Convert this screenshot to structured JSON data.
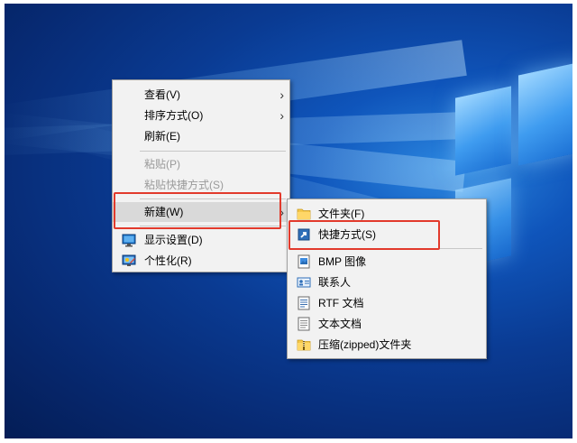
{
  "context_menu": {
    "items": [
      {
        "label": "查看(V)"
      },
      {
        "label": "排序方式(O)"
      },
      {
        "label": "刷新(E)"
      },
      {
        "label": "粘贴(P)"
      },
      {
        "label": "粘贴快捷方式(S)"
      },
      {
        "label": "新建(W)"
      },
      {
        "label": "显示设置(D)",
        "icon": "display-icon"
      },
      {
        "label": "个性化(R)",
        "icon": "personalize-icon"
      }
    ]
  },
  "submenu_new": {
    "items": [
      {
        "label": "文件夹(F)",
        "icon": "folder-icon"
      },
      {
        "label": "快捷方式(S)",
        "icon": "shortcut-icon"
      },
      {
        "label": "BMP 图像",
        "icon": "bmp-image-icon"
      },
      {
        "label": "联系人",
        "icon": "contact-icon"
      },
      {
        "label": "RTF 文档",
        "icon": "rtf-document-icon"
      },
      {
        "label": "文本文档",
        "icon": "text-document-icon"
      },
      {
        "label": "压缩(zipped)文件夹",
        "icon": "zip-folder-icon"
      }
    ]
  },
  "colors": {
    "highlight_box": "#e23a2c",
    "menu_background": "#f2f2f2",
    "hover_background": "#d9d9d9"
  }
}
